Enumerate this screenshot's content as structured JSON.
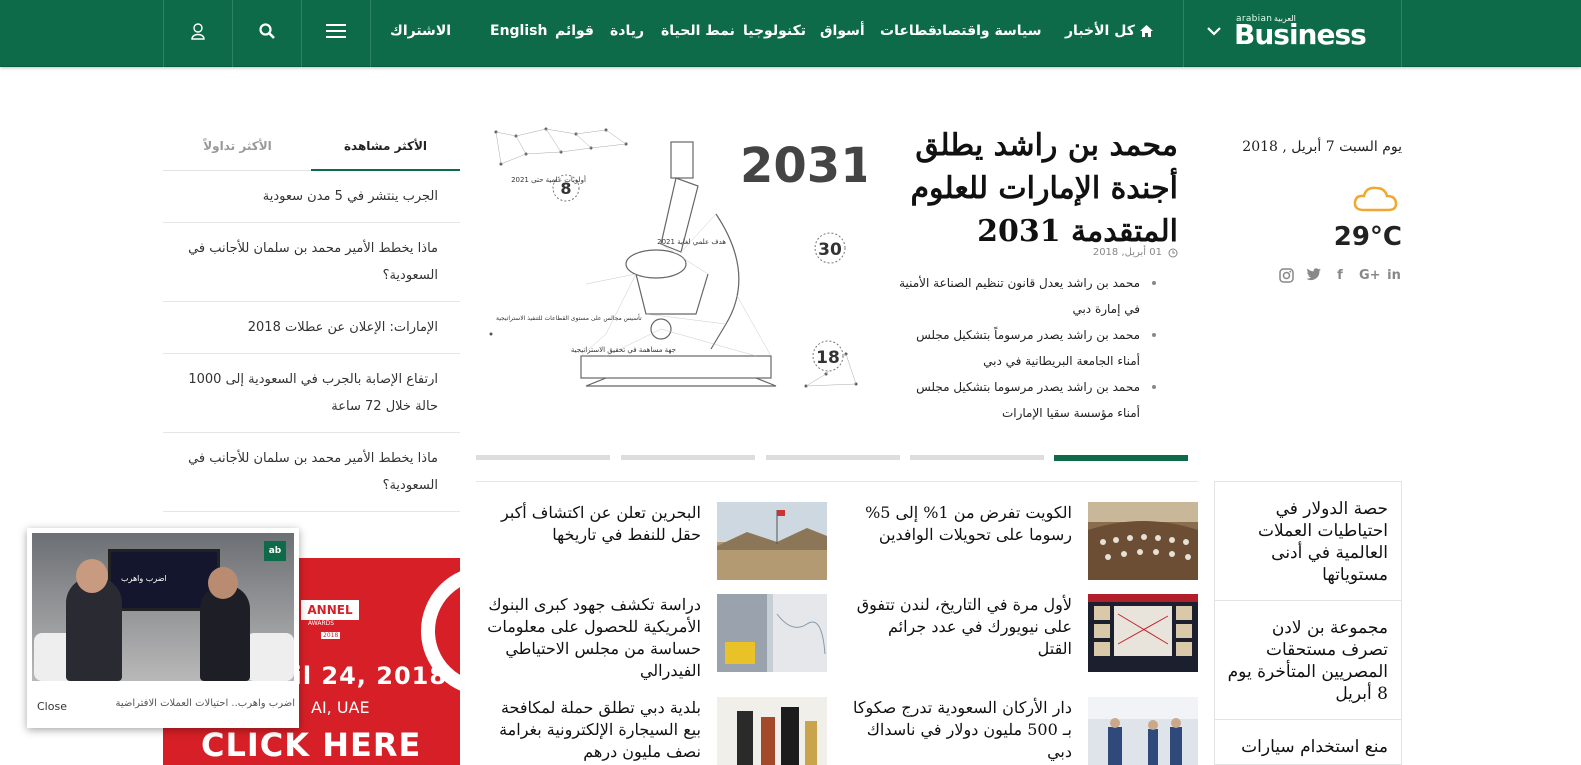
{
  "nav": {
    "logo_small": "arabian",
    "logo_arabic": "العربية",
    "logo_big": "Business",
    "items": [
      {
        "label": "كل الأخبار"
      },
      {
        "label": "سياسة واقتصاد"
      },
      {
        "label": "قطاعات"
      },
      {
        "label": "أسواق"
      },
      {
        "label": "تكنولوجيا"
      },
      {
        "label": "نمط الحياة"
      },
      {
        "label": "ريادة"
      },
      {
        "label": "قوائم"
      },
      {
        "label": "English"
      }
    ],
    "subscribe": "الاشتراك",
    "icons": [
      "home-icon",
      "chevron-down-icon",
      "menu-icon",
      "search-icon",
      "user-icon"
    ],
    "color": "#0d6b4a"
  },
  "tabs": {
    "most_watched": "الأكثر مشاهدة",
    "most_traded": "الأكثر تداولاً"
  },
  "most_watched": [
    "الجرب ينتشر في 5 مدن سعودية",
    "ماذا يخطط الأمير محمد بن سلمان للأجانب في السعودية؟",
    "الإمارات: الإعلان عن عطلات 2018",
    "ارتفاع الإصابة بالجرب في السعودية إلى 1000 حالة خلال 72 ساعة",
    "ماذا يخطط الأمير محمد بن سلمان للأجانب في السعودية؟"
  ],
  "ad": {
    "badge": "ANNEL",
    "badge_sub": "AWARDS",
    "year": "2018",
    "date": "April 24, 2018",
    "place": "AI, UAE",
    "cta": "CLICK HERE"
  },
  "popup": {
    "close": "Close",
    "caption": "اضرب واهرب.. احتيالات العملات الافتراضية",
    "screen_text": "اضرب واهرب",
    "logo": "ab"
  },
  "hero": {
    "title": "محمد بن راشد يطلق أجندة الإمارات للعلوم المتقدمة 2031",
    "date": "01 أبريل, 2018",
    "bullets": [
      "محمد بن راشد يعدل قانون تنظيم الصناعة الأمنية في إمارة دبي",
      "محمد بن راشد يصدر مرسوماً بتشكيل مجلس أمناء الجامعة البريطانية في دبي",
      "محمد بن راشد يصدر مرسوما بتشكيل مجلس أمناء مؤسسة سقيا الإمارات"
    ],
    "image": {
      "year": "2031",
      "label_8": "أولويات علمية حتى 2021",
      "label_30": "هدف علمي لغاية 2021",
      "label_strategic": "تأسيس مجالس على مستوى القطاعات للتنفيذ الاستراتيجية",
      "label_18": "جهة مساهمة في تحقيق الاستراتيجية",
      "num_8": "8",
      "num_30": "30",
      "num_18": "18"
    }
  },
  "articles": [
    {
      "title": "الكويت تفرض من 1% إلى 5% رسوما على تحويلات الوافدين"
    },
    {
      "title": "البحرين تعلن عن اكتشاف أكبر حقل للنفط في تاريخها"
    },
    {
      "title": "لأول مرة في التاريخ، لندن تتفوق على نيويورك في عدد جرائم القتل"
    },
    {
      "title": "دراسة تكشف جهود كبرى البنوك الأمريكية للحصول على معلومات حساسة من مجلس الاحتياطي الفيدرالي"
    },
    {
      "title": "دار الأركان السعودية تدرج صكوكا بـ 500 مليون دولار في ناسداك دبي"
    },
    {
      "title": "بلدية دبي تطلق حملة لمكافحة بيع السيجارة الإلكترونية بغرامة نصف مليون درهم"
    }
  ],
  "sidebar": {
    "date": "يوم السبت 7 أبريل , 2018",
    "temperature": "29°C",
    "weather_icon": "cloud-sun-icon",
    "socials": [
      "linkedin-icon",
      "google-plus-icon",
      "facebook-icon",
      "twitter-icon",
      "instagram-icon"
    ],
    "headlines": [
      "حصة الدولار في احتياطيات العملات العالمية في أدنى مستوياتها",
      "مجموعة بن لادن تصرف مستحقات المصريين المتأخرة يوم 8 أبريل",
      "منع استخدام سيارات"
    ]
  }
}
